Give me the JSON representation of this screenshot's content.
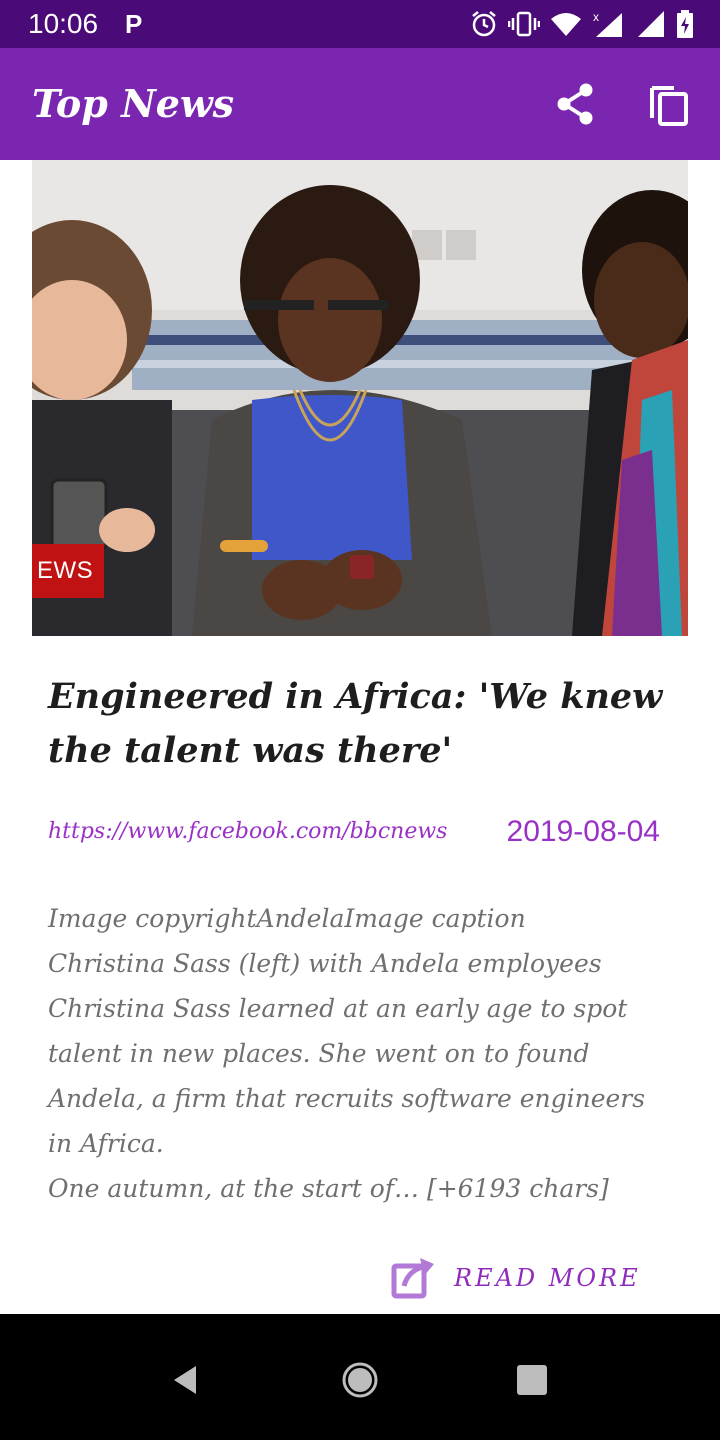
{
  "status_bar": {
    "time": "10:06",
    "notification_icon": "P",
    "icons": [
      "alarm-icon",
      "vibrate-icon",
      "wifi-icon",
      "signal-icon",
      "signal-icon",
      "battery-charging-icon"
    ]
  },
  "app_bar": {
    "title": "Top News",
    "actions": [
      "share-icon",
      "copy-icon"
    ],
    "color": "#7b26b0"
  },
  "article": {
    "image_tag": "EWS",
    "title": "Engineered in Africa: 'We knew the talent was there'",
    "source_url": "https://www.facebook.com/bbcnews",
    "date": "2019-08-04",
    "body": "Image copyrightAndelaImage caption\n Christina Sass (left) with Andela employees\nChristina Sass learned at an early age to spot talent in new places. She went on to found Andela, a firm that recruits software engineers in Africa.\nOne autumn, at the start of… [+6193 chars]",
    "read_more_label": "READ MORE",
    "accent_color": "#9a31c6"
  },
  "nav_bar": {
    "buttons": [
      "back-icon",
      "home-icon",
      "recents-icon"
    ]
  }
}
